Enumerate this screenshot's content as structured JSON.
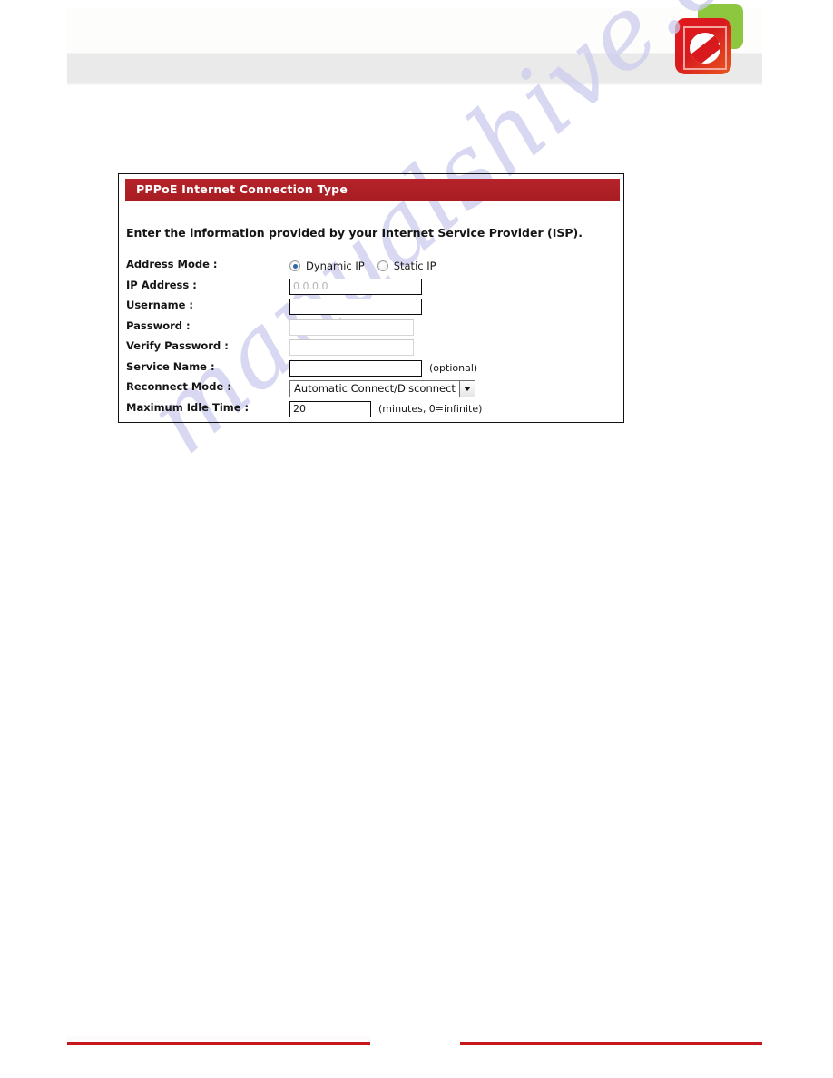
{
  "header": {
    "logo": {
      "name": "brand-logo",
      "front_color": "#d81a1f",
      "back_color": "#8dc63f",
      "glyph": "e-swirl-icon"
    }
  },
  "watermark": {
    "text": "manualshive.com",
    "color": "#ccccee"
  },
  "panel": {
    "title": "PPPoE Internet Connection Type",
    "title_bar_color": "#b02025",
    "intro": "Enter the information provided by your Internet Service Provider (ISP).",
    "rows": [
      {
        "label": "Address Mode :",
        "type": "radio",
        "options": [
          {
            "label": "Dynamic IP",
            "selected": true
          },
          {
            "label": "Static IP",
            "selected": false
          }
        ]
      },
      {
        "label": "IP Address :",
        "type": "text",
        "value": "",
        "placeholder": "0.0.0.0",
        "hint": ""
      },
      {
        "label": "Username :",
        "type": "text",
        "value": "",
        "placeholder": "",
        "hint": ""
      },
      {
        "label": "Password :",
        "type": "password",
        "value": "",
        "placeholder": "",
        "hint": ""
      },
      {
        "label": "Verify Password :",
        "type": "password",
        "value": "",
        "placeholder": "",
        "hint": ""
      },
      {
        "label": "Service Name :",
        "type": "text",
        "value": "",
        "placeholder": "",
        "hint": "(optional)"
      },
      {
        "label": "Reconnect Mode :",
        "type": "select",
        "value": "Automatic Connect/Disconnect",
        "hint": ""
      },
      {
        "label": "Maximum Idle Time :",
        "type": "text",
        "value": "20",
        "placeholder": "",
        "hint": "(minutes, 0=infinite)"
      }
    ]
  },
  "footer": {
    "rule_color": "#c8161d"
  }
}
